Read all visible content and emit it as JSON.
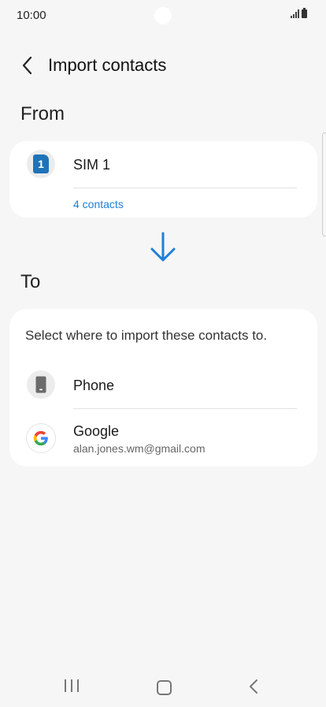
{
  "status_bar": {
    "time": "10:00"
  },
  "header": {
    "title": "Import contacts"
  },
  "from": {
    "label": "From",
    "source": {
      "name": "SIM 1",
      "badge": "1",
      "contacts": "4 contacts"
    }
  },
  "to": {
    "label": "To",
    "hint": "Select where to import these contacts to.",
    "options": [
      {
        "name": "Phone"
      },
      {
        "name": "Google",
        "account": "alan.jones.wm@gmail.com"
      }
    ]
  },
  "colors": {
    "accent": "#1e7fd6",
    "sim_badge": "#1f73b7",
    "background": "#f6f6f6"
  }
}
